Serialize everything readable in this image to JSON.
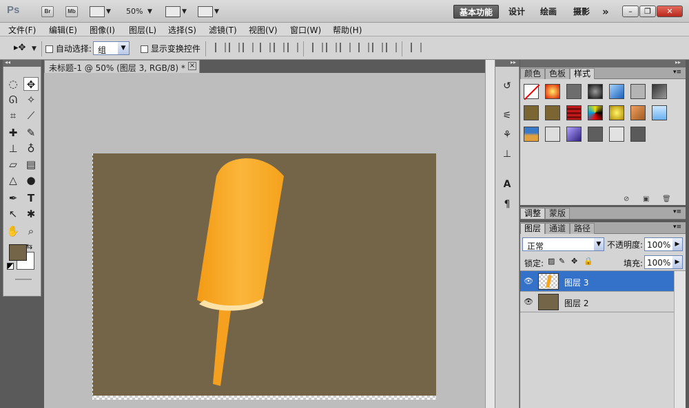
{
  "app": {
    "logo": "Ps",
    "bridge": "Br",
    "minibridge": "Mb",
    "zoom": "50%"
  },
  "workspaces": [
    "基本功能",
    "设计",
    "绘画",
    "摄影"
  ],
  "workspace_more": "»",
  "menu": [
    "文件(F)",
    "编辑(E)",
    "图像(I)",
    "图层(L)",
    "选择(S)",
    "滤镜(T)",
    "视图(V)",
    "窗口(W)",
    "帮助(H)"
  ],
  "options": {
    "auto_select_label": "自动选择:",
    "auto_select_value": "组",
    "show_transform_label": "显示变换控件"
  },
  "document": {
    "tab_title": "未标题-1 @ 50% (图层 3, RGB/8) *",
    "close": "×"
  },
  "colors": {
    "foreground": "#756548",
    "background": "#ffffff",
    "canvas": "#756548",
    "popsicle": "#f7a51f",
    "stick": "#f5a01e",
    "selected_layer": "#3471c9"
  },
  "style_panel": {
    "tabs": [
      "颜色",
      "色板",
      "样式"
    ],
    "active_tab": "样式"
  },
  "adjust_panel": {
    "tabs": [
      "调整",
      "蒙版"
    ]
  },
  "layers_panel": {
    "tabs": [
      "图层",
      "通道",
      "路径"
    ],
    "blend_mode": "正常",
    "opacity_label": "不透明度:",
    "opacity": "100%",
    "lock_label": "锁定:",
    "fill_label": "填充:",
    "fill": "100%",
    "layers": [
      {
        "name": "图层 3",
        "selected": true
      },
      {
        "name": "图层 2",
        "selected": false
      }
    ]
  }
}
